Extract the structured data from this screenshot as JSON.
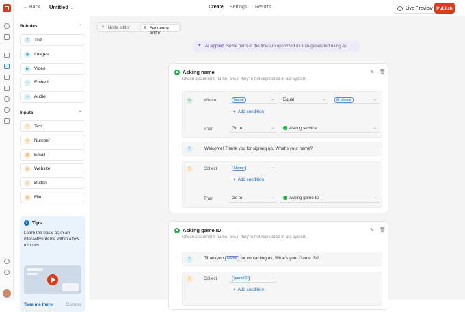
{
  "topbar": {
    "back": "Back",
    "title": "Untitled",
    "tabs": [
      "Create",
      "Settings",
      "Results"
    ],
    "live_preview": "Live Preview",
    "publish": "Publish"
  },
  "sidebar": {
    "bubbles_title": "Bubbles",
    "bubbles": [
      "Text",
      "Images",
      "Video",
      "Embed",
      "Audio"
    ],
    "inputs_title": "Inputs",
    "inputs": [
      "Text",
      "Number",
      "Email",
      "Website",
      "Button",
      "File"
    ],
    "tips": {
      "title": "Tips",
      "body": "Learn the basic as in an interactive demo within a few minutes",
      "take_me": "Take me there",
      "dismiss": "Dismiss"
    }
  },
  "editor": {
    "node_editor": "Node editor",
    "sequence_editor": "Sequence editor",
    "ai_label": "AI Applied",
    "ai_text": "Some parts of the flow are optimized or auto-generated using AI."
  },
  "card1": {
    "title": "Asking name",
    "subtitle": "Check customer's name, aks if they're not registered in out system.",
    "where_label": "Where",
    "cond_field": "Name",
    "cond_op": "Equal",
    "cond_value": "phone",
    "add_condition": "Add condition",
    "then_label": "Then",
    "then_action": "Go to",
    "then_target": "Asking service",
    "message": "Welcome! Thank you for signing up, What's your name?",
    "collect_label": "Collect",
    "collect_field": "Name",
    "add_condition2": "Add condition",
    "then_label2": "Then",
    "then_action2": "Go to",
    "then_target2": "Asking game ID"
  },
  "card2": {
    "title": "Asking game ID",
    "subtitle": "Check customer's name, aks if they're not registered in out system.",
    "msg_pre": "Thankyou",
    "msg_chip": "Name",
    "msg_post": "for contacting us, What's your Game ID?",
    "collect_label": "Collect",
    "collect_field": "gameID",
    "add_condition": "Add condition"
  }
}
